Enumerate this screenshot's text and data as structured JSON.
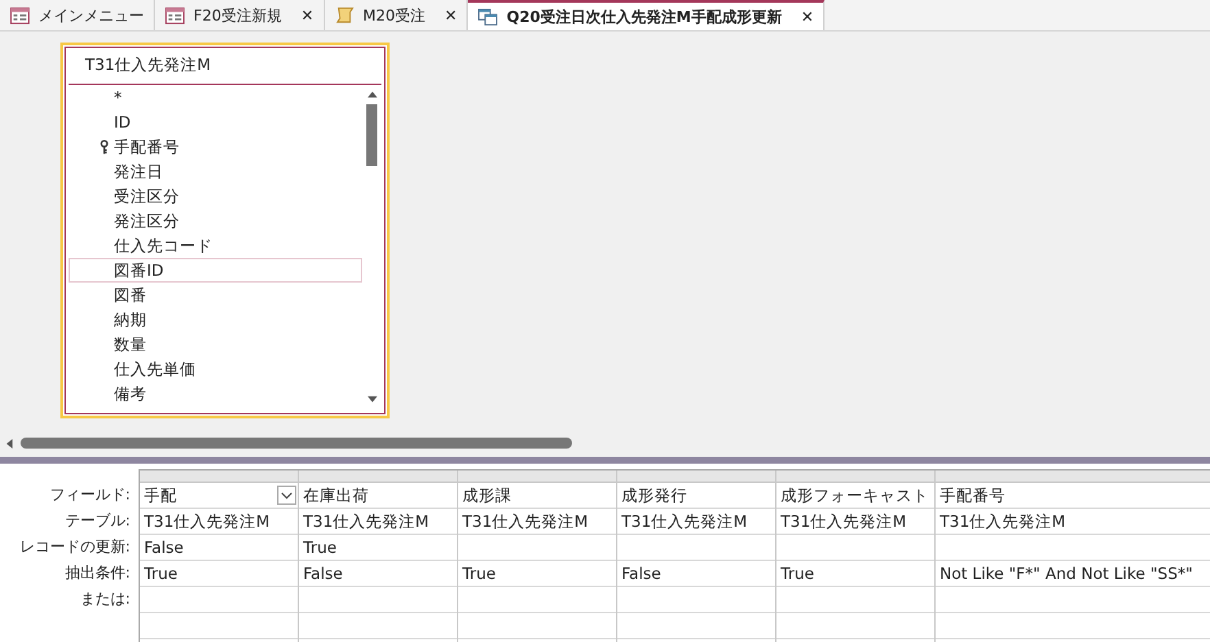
{
  "tabs": [
    {
      "label": "メインメニュー",
      "kind": "menu",
      "selected": false,
      "closable": false
    },
    {
      "label": "F20受注新規",
      "kind": "form",
      "selected": false,
      "closable": true
    },
    {
      "label": "M20受注",
      "kind": "macro",
      "selected": false,
      "closable": true
    },
    {
      "label": "Q20受注日次仕入先発注M手配成形更新",
      "kind": "query",
      "selected": true,
      "closable": true
    }
  ],
  "close_glyph": "✕",
  "field_list": {
    "title": "T31仕入先発注M",
    "fields": [
      {
        "name": "*",
        "key": false,
        "selected": false
      },
      {
        "name": "ID",
        "key": false,
        "selected": false
      },
      {
        "name": "手配番号",
        "key": true,
        "selected": false
      },
      {
        "name": "発注日",
        "key": false,
        "selected": false
      },
      {
        "name": "受注区分",
        "key": false,
        "selected": false
      },
      {
        "name": "発注区分",
        "key": false,
        "selected": false
      },
      {
        "name": "仕入先コード",
        "key": false,
        "selected": false
      },
      {
        "name": "図番ID",
        "key": false,
        "selected": true
      },
      {
        "name": "図番",
        "key": false,
        "selected": false
      },
      {
        "name": "納期",
        "key": false,
        "selected": false
      },
      {
        "name": "数量",
        "key": false,
        "selected": false
      },
      {
        "name": "仕入先単価",
        "key": false,
        "selected": false
      },
      {
        "name": "備考",
        "key": false,
        "selected": false
      }
    ]
  },
  "grid": {
    "row_labels": [
      "フィールド:",
      "テーブル:",
      "レコードの更新:",
      "抽出条件:",
      "または:"
    ],
    "columns": [
      {
        "field": "手配",
        "table": "T31仕入先発注M",
        "update": "False",
        "criteria": "True",
        "dropdown": true
      },
      {
        "field": "在庫出荷",
        "table": "T31仕入先発注M",
        "update": "True",
        "criteria": "False",
        "dropdown": false
      },
      {
        "field": "成形課",
        "table": "T31仕入先発注M",
        "criteria": "True",
        "dropdown": false
      },
      {
        "field": "成形発行",
        "table": "T31仕入先発注M",
        "criteria": "False",
        "dropdown": false
      },
      {
        "field": "成形フォーキャスト",
        "table": "T31仕入先発注M",
        "criteria": "True",
        "dropdown": false
      },
      {
        "field": "手配番号",
        "table": "T31仕入先発注M",
        "criteria": "Not Like \"F*\" And Not Like \"SS*\"",
        "dropdown": false
      }
    ]
  }
}
